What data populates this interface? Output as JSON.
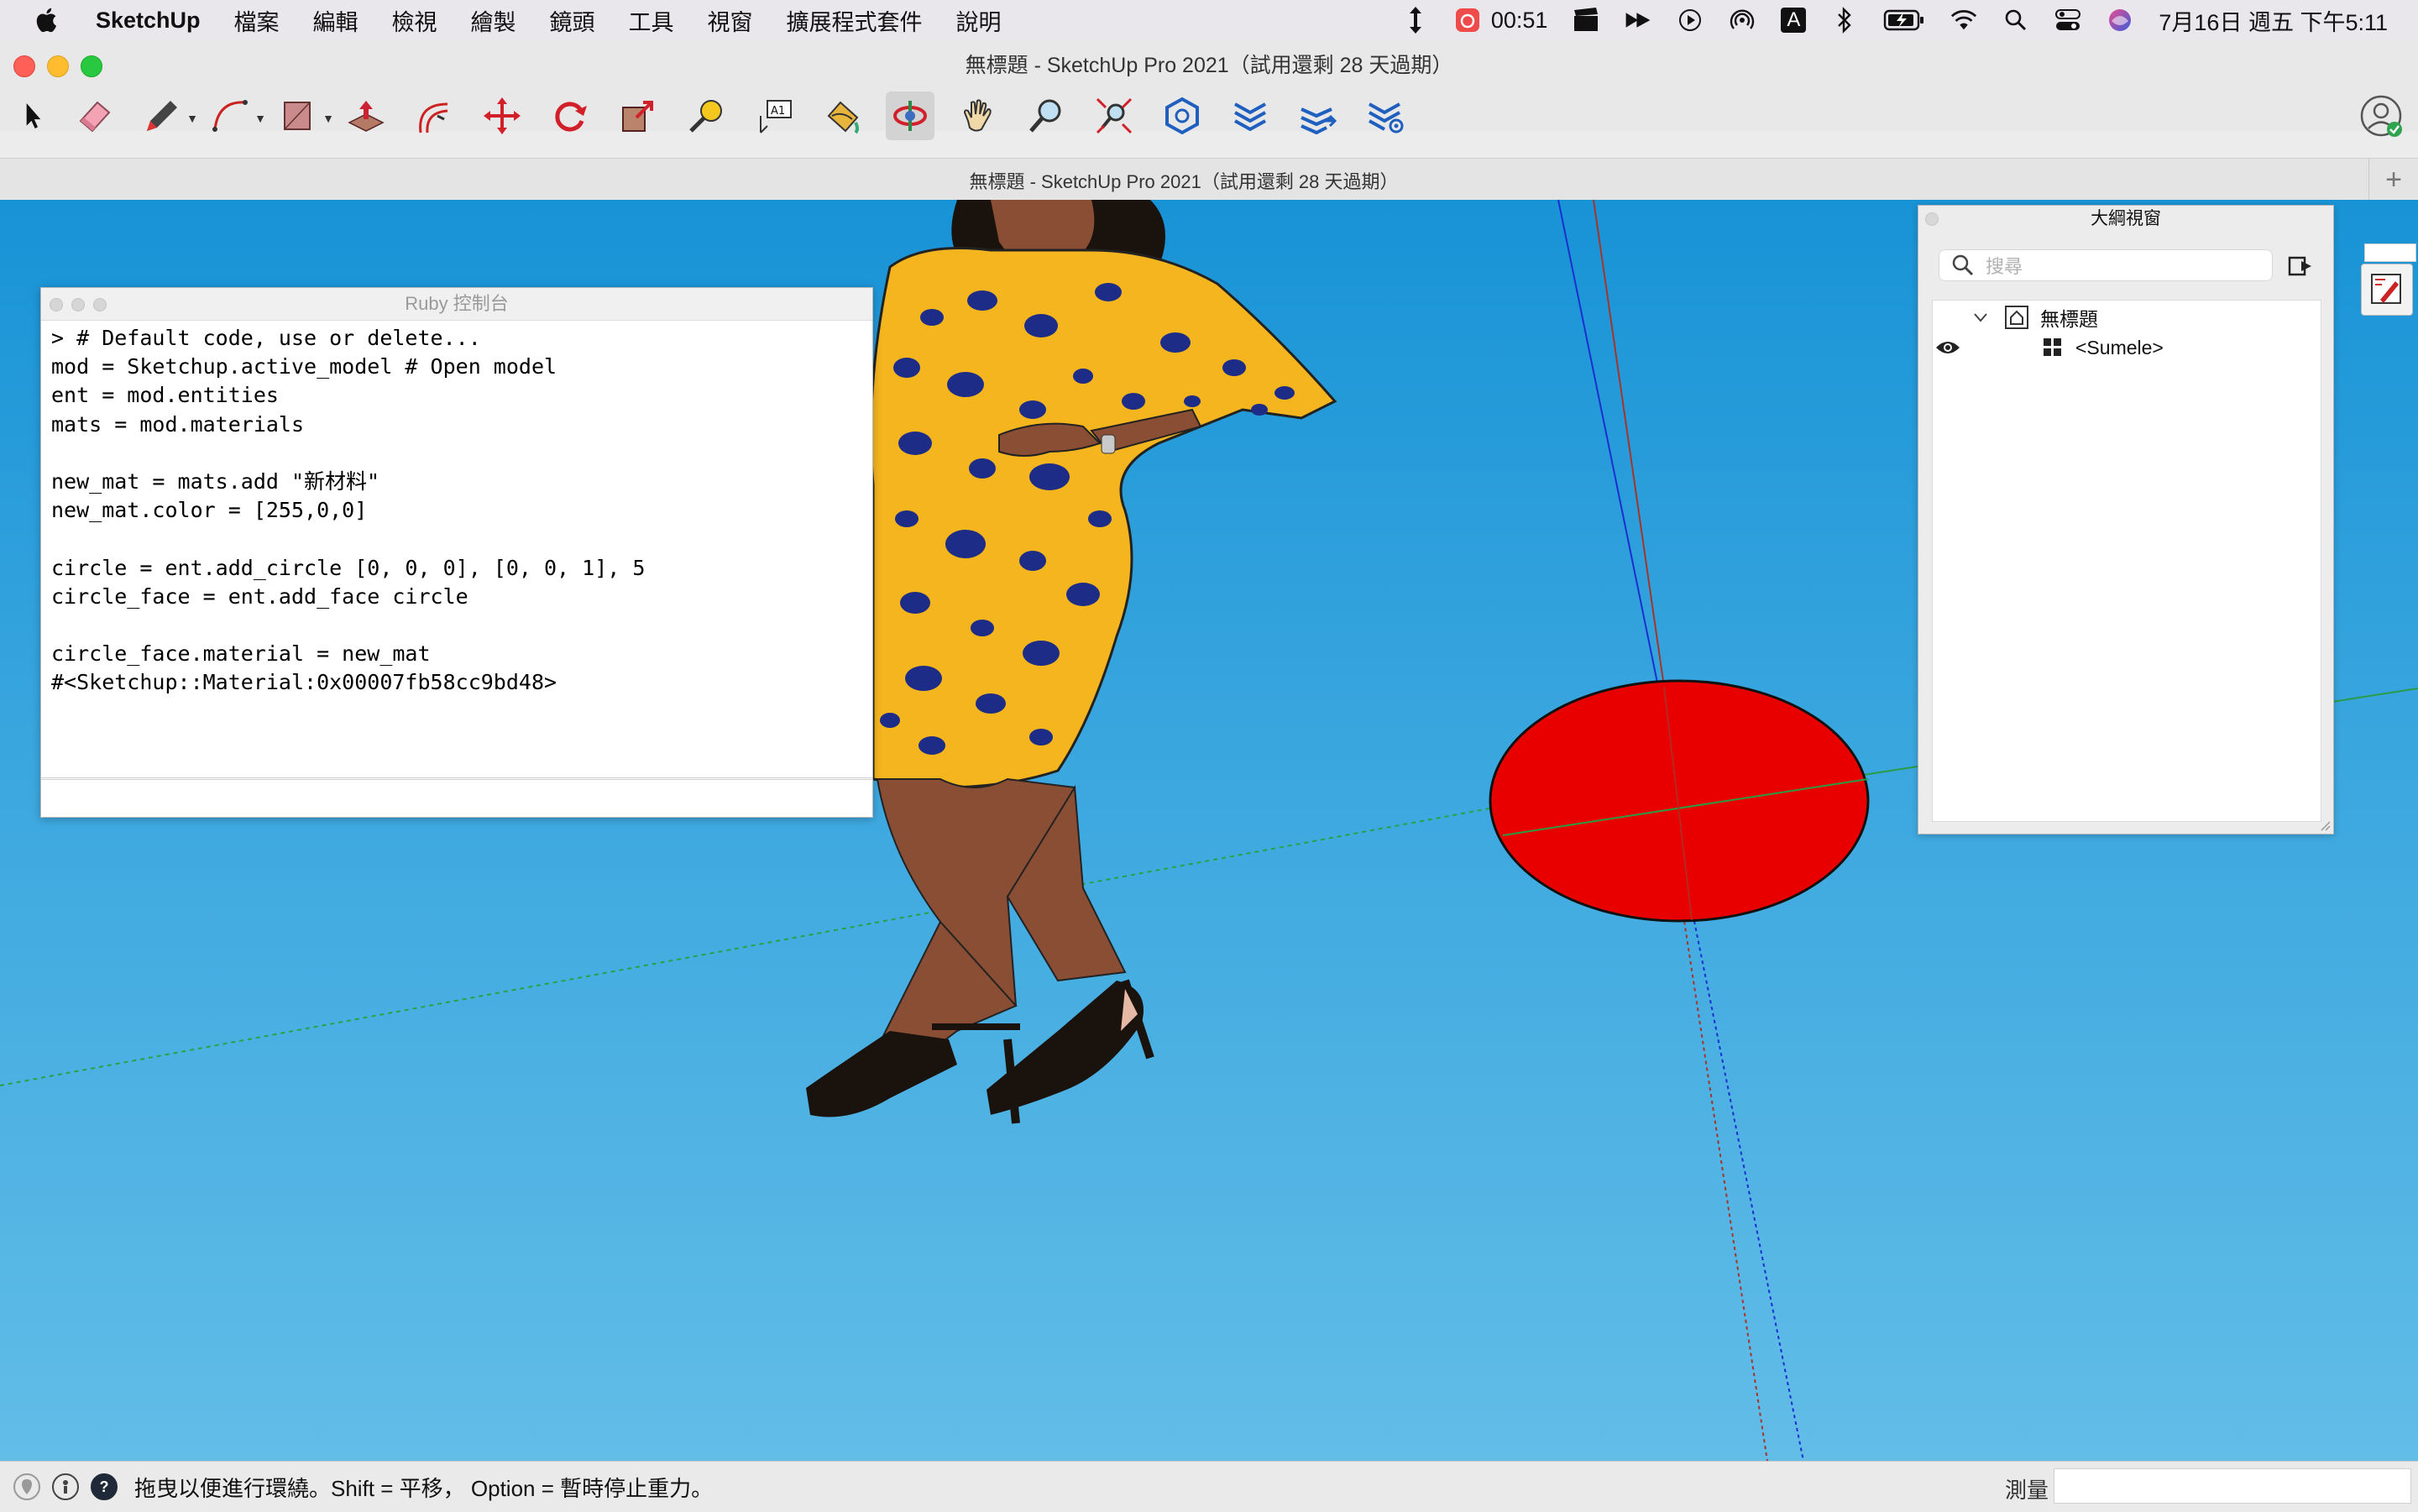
{
  "menubar": {
    "app_name": "SketchUp",
    "menus": [
      "檔案",
      "編輯",
      "檢視",
      "繪製",
      "鏡頭",
      "工具",
      "視窗",
      "擴展程式套件",
      "說明"
    ],
    "status": {
      "timer": "00:51",
      "datetime": "7月16日 週五 下午5:11",
      "input_source": "A"
    }
  },
  "window": {
    "title": "無標題 - SketchUp Pro 2021（試用還剩 28 天過期）",
    "tab_title": "無標題 - SketchUp Pro 2021（試用還剩 28 天過期）",
    "add_tab": "+"
  },
  "toolbar": {
    "tools": [
      "select-tool",
      "eraser-tool",
      "pencil-tool",
      "arc-tool",
      "shape-tool",
      "push-pull-tool",
      "offset-tool",
      "move-tool",
      "rotate-tool",
      "scale-tool",
      "tape-measure-tool",
      "text-tool",
      "paint-bucket-tool",
      "orbit-tool",
      "pan-tool",
      "zoom-tool",
      "zoom-extents-tool",
      "warehouse-tool",
      "extension-warehouse-tool",
      "layout-tool",
      "extension-manager-tool"
    ],
    "text_tool_label": "A1"
  },
  "ruby_console": {
    "title": "Ruby 控制台",
    "lines": [
      "> # Default code, use or delete...",
      "mod = Sketchup.active_model # Open model",
      "ent = mod.entities",
      "mats = mod.materials",
      "",
      "new_mat = mats.add \"新材料\"",
      "new_mat.color = [255,0,0]",
      "",
      "circle = ent.add_circle [0, 0, 0], [0, 0, 1], 5",
      "circle_face = ent.add_face circle",
      "",
      "circle_face.material = new_mat",
      "#<Sketchup::Material:0x00007fb58cc9bd48>"
    ]
  },
  "outliner": {
    "title": "大綱視窗",
    "search_placeholder": "搜尋",
    "root_label": "無標題",
    "child_label": "<Sumele>"
  },
  "statusbar": {
    "hint": "拖曳以便進行環繞。Shift = 平移， Option = 暫時停止重力。",
    "measure_label": "測量",
    "help_icon": "?"
  },
  "colors": {
    "sky_top": "#1893d6",
    "sky_bottom": "#62bde7",
    "circle_fill": "#e80000",
    "dress": "#f5b51f",
    "dots": "#1d2c86",
    "skin": "#8a4e35"
  }
}
